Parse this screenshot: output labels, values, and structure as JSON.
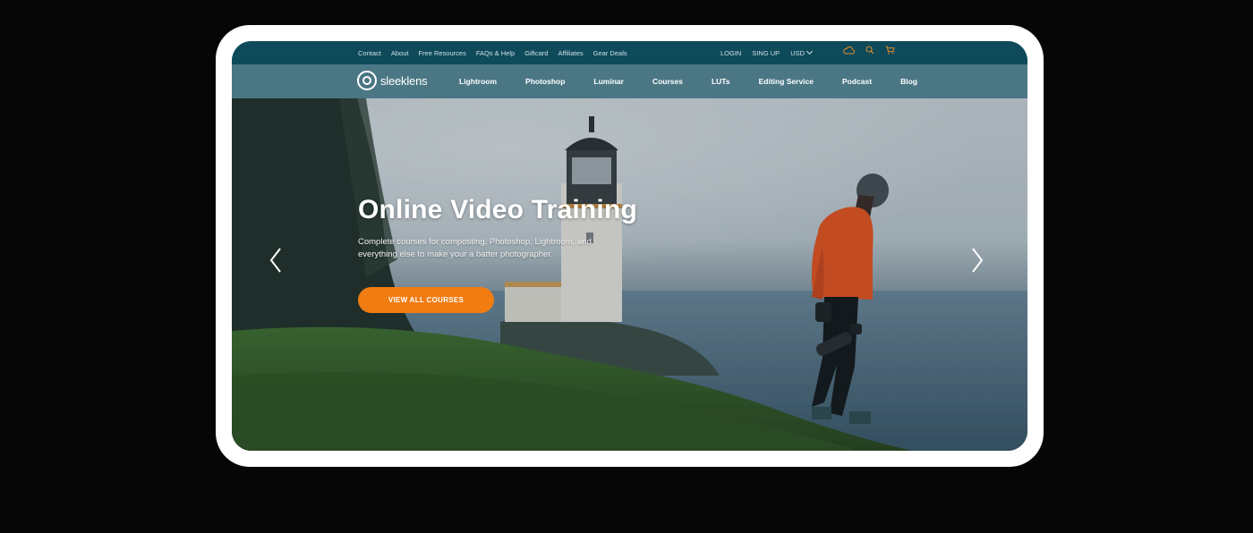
{
  "top_links": [
    "Contact",
    "About",
    "Free Resources",
    "FAQs & Help",
    "Giftcard",
    "Affiliates",
    "Gear Deals"
  ],
  "auth": {
    "login": "LOGIN",
    "signup": "SING UP",
    "currency": "USD"
  },
  "icons": {
    "cloud": "cloud-icon",
    "search": "search-icon",
    "cart": "cart-icon",
    "prev": "chevron-left-icon",
    "next": "chevron-right-icon"
  },
  "brand": {
    "name": "sleeklens"
  },
  "nav": [
    "Lightroom",
    "Photoshop",
    "Luminar",
    "Courses",
    "LUTs",
    "Editing Service",
    "Podcast",
    "Blog"
  ],
  "hero": {
    "title": "Online Video Training",
    "subtitle": "Complete courses for composting, Photoshop, Lightroom, and everything else to make your a batter photographer.",
    "cta": "VIEW ALL COURSES"
  },
  "colors": {
    "accent": "#f07c12",
    "topbar": "#0e4a5a",
    "navbar": "#4b7785",
    "icon_accent": "#e08a2a"
  }
}
